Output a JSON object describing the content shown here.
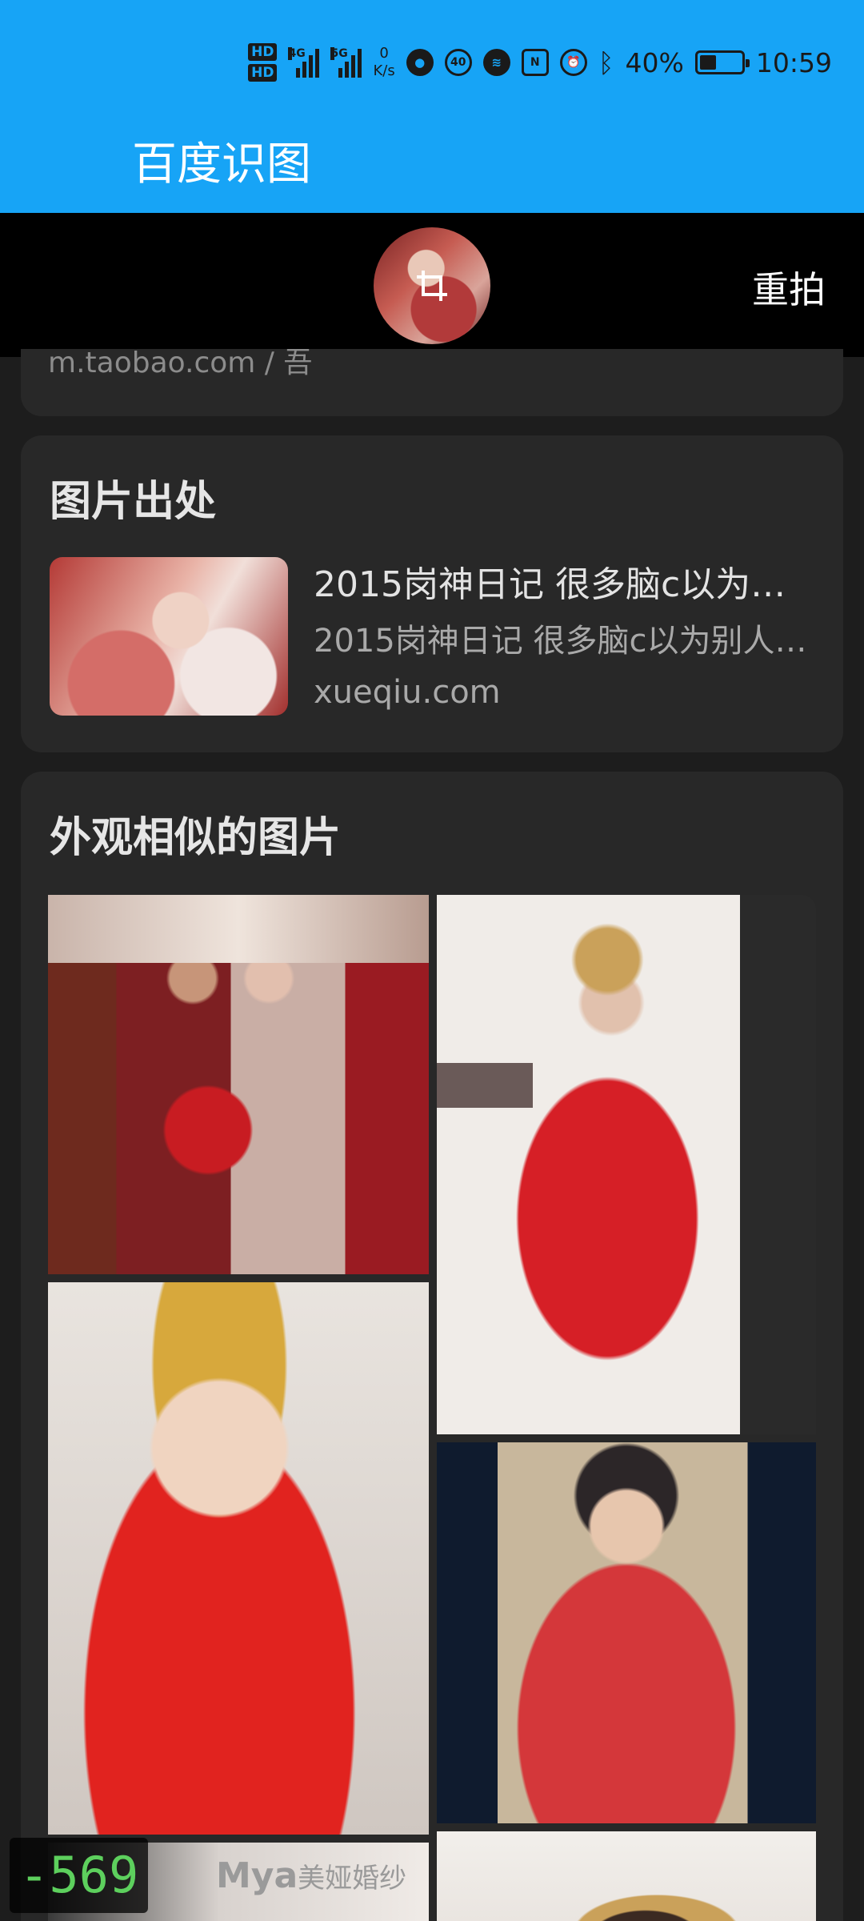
{
  "status_bar": {
    "hd1": "HD",
    "hd2": "HD",
    "net1": "4G",
    "net2": "5G",
    "speed_value": "0",
    "speed_unit": "K/s",
    "badge_40": "40",
    "nfc": "N",
    "battery_percent": "40%",
    "battery_level": 0.4,
    "time": "10:59"
  },
  "app": {
    "title": "百度识图"
  },
  "query": {
    "retake_label": "重拍"
  },
  "top_card": {
    "source_text": "m.taobao.com  /  吾"
  },
  "source_card": {
    "title": "图片出处",
    "item": {
      "title": "2015岗神日记 很多脑c以为…",
      "description": "2015岗神日记 很多脑c以为别人…",
      "domain": "xueqiu.com"
    }
  },
  "similar_card": {
    "title": "外观相似的图片",
    "bottom_label_main": "Mya",
    "bottom_label_sub": "美娅婚纱"
  },
  "debug_counter": "-569"
}
